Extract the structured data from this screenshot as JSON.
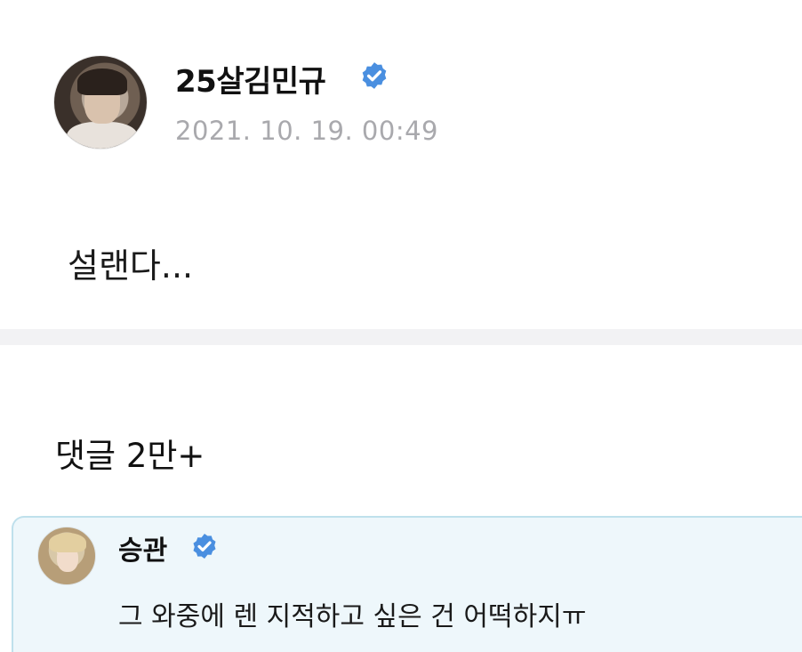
{
  "post": {
    "author": "25살김민규",
    "date": "2021. 10. 19. 00:49",
    "body": "설랜다..."
  },
  "comments": {
    "header": "댓글 2만+",
    "items": [
      {
        "author": "승관",
        "text": "그 와중에 렌 지적하고 싶은 건 어떡하지ㅠ"
      }
    ]
  },
  "icons": {
    "verified": "verified-badge-icon",
    "verified_color": "#4a8fe0"
  },
  "colors": {
    "comment_bg": "#eef7fb",
    "comment_border": "#bfe0ec",
    "date_gray": "#a9a9ad"
  }
}
